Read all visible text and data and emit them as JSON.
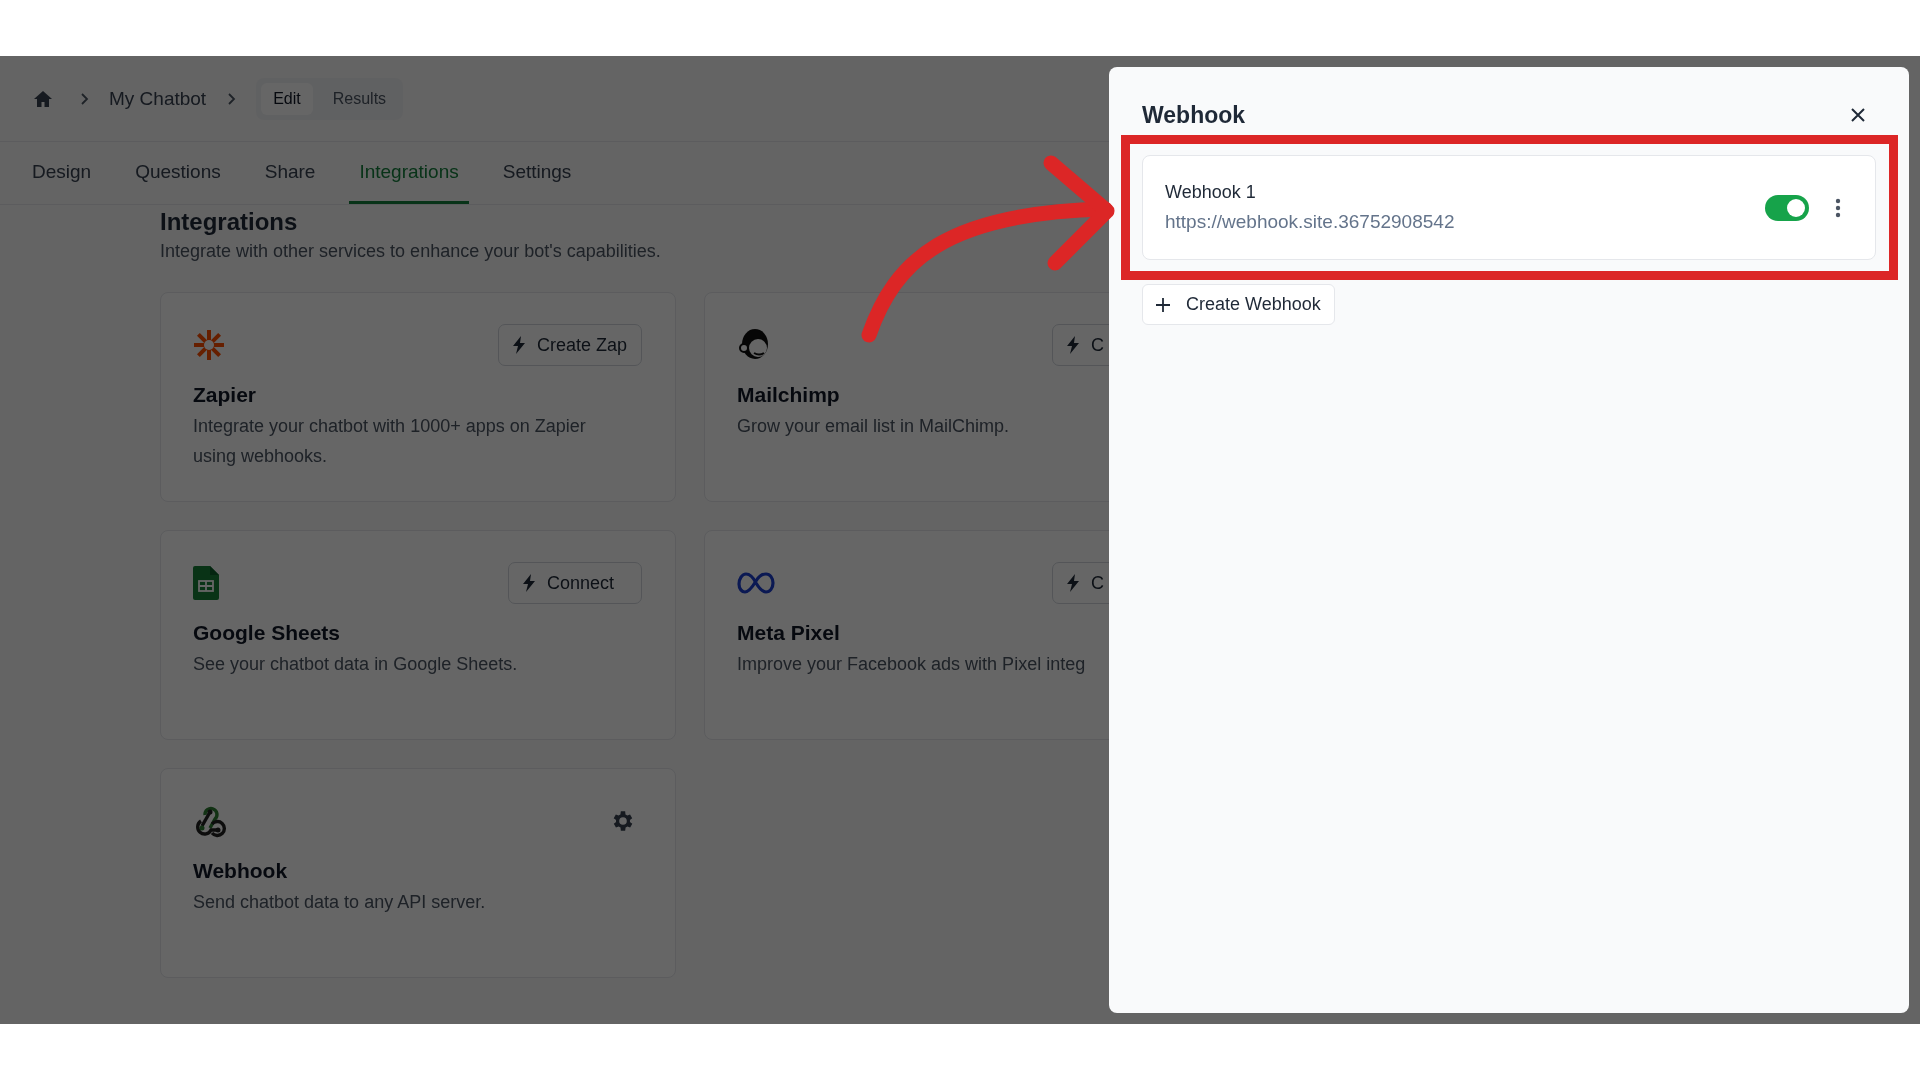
{
  "breadcrumb": {
    "items": [
      {
        "label": "My Chatbot"
      }
    ],
    "modes": [
      {
        "label": "Edit",
        "selected": true
      },
      {
        "label": "Results",
        "selected": false
      }
    ]
  },
  "tabs": [
    {
      "label": "Design",
      "selected": false
    },
    {
      "label": "Questions",
      "selected": false
    },
    {
      "label": "Share",
      "selected": false
    },
    {
      "label": "Integrations",
      "selected": true
    },
    {
      "label": "Settings",
      "selected": false
    }
  ],
  "page": {
    "title": "Integrations",
    "subtitle": "Integrate with other services to enhance your bot's capabilities."
  },
  "integrations": [
    {
      "kind": "asterisk",
      "name": "Zapier",
      "description": "Integrate your chatbot with 1000+ apps on Zapier using webhooks.",
      "action": {
        "kind": "button",
        "label": "Create Zap"
      }
    },
    {
      "kind": "monkey",
      "name": "Mailchimp",
      "description": "Grow your email list in MailChimp.",
      "action": {
        "kind": "button",
        "label": "C"
      }
    },
    {
      "kind": "sheet",
      "name": "Google Sheets",
      "description": "See your chatbot data in Google Sheets.",
      "action": {
        "kind": "button",
        "label": "Connect"
      }
    },
    {
      "kind": "infinity",
      "name": "Meta Pixel",
      "description": "Improve your Facebook ads with Pixel integ",
      "action": {
        "kind": "button",
        "label": "C"
      }
    },
    {
      "kind": "webhook",
      "name": "Webhook",
      "description": "Send chatbot data to any API server.",
      "action": {
        "kind": "settings"
      }
    }
  ],
  "panel": {
    "title": "Webhook",
    "webhooks": [
      {
        "name": "Webhook 1",
        "url": "https://webhook.site.36752908542",
        "on": true,
        "highlighted": true
      }
    ],
    "create_button": "Create Webhook"
  }
}
